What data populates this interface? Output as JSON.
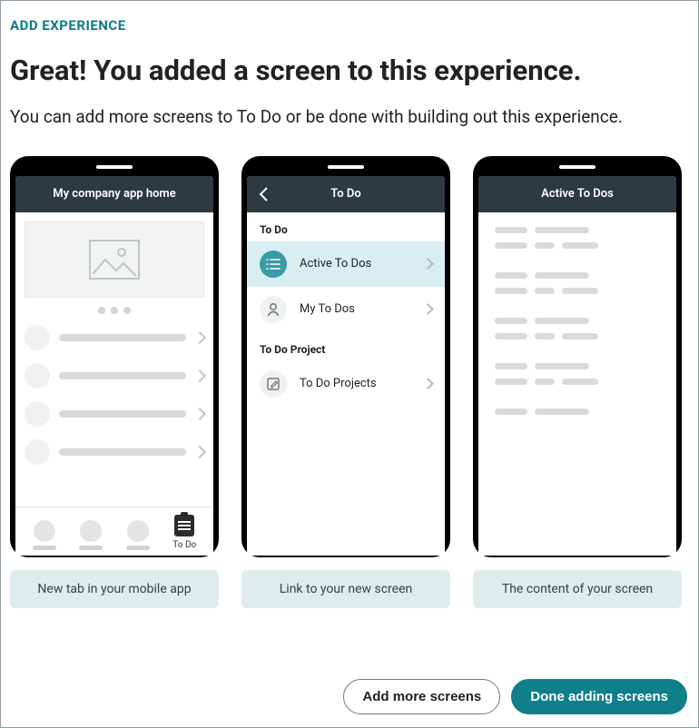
{
  "eyebrow": "ADD EXPERIENCE",
  "title": "Great! You added a screen to this experience.",
  "subtitle": "You can add more screens to To Do or be done with building out this experience.",
  "phone1": {
    "header": "My company app home",
    "activeTab": "To Do"
  },
  "phone2": {
    "header": "To Do",
    "section1": "To Do",
    "item1": "Active To Dos",
    "item2": "My To Dos",
    "section2": "To Do Project",
    "item3": "To Do Projects"
  },
  "phone3": {
    "header": "Active To Dos"
  },
  "caption1": "New tab in your mobile app",
  "caption2": "Link to your new screen",
  "caption3": "The content of your screen",
  "buttons": {
    "secondary": "Add more screens",
    "primary": "Done adding screens"
  }
}
